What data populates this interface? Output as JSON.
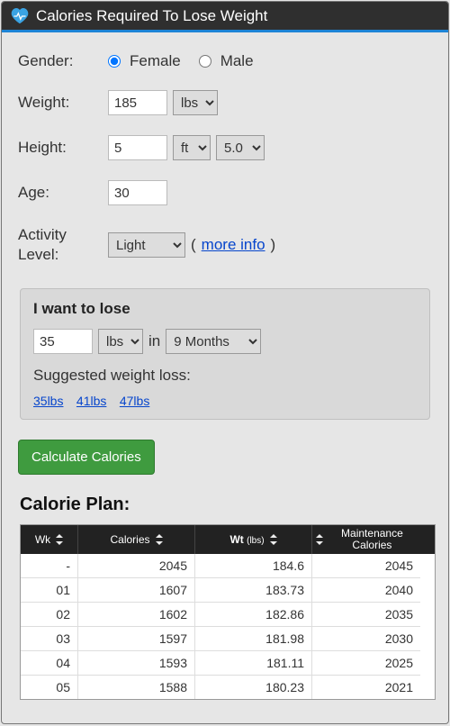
{
  "title": "Calories Required To Lose Weight",
  "form": {
    "gender": {
      "label": "Gender:",
      "female": "Female",
      "male": "Male",
      "selected": "female"
    },
    "weight": {
      "label": "Weight:",
      "value": "185",
      "unit": "lbs"
    },
    "height": {
      "label": "Height:",
      "value": "5",
      "unit": "ft",
      "inches": "5.0"
    },
    "age": {
      "label": "Age:",
      "value": "30"
    },
    "activity": {
      "label1": "Activity",
      "label2": "Level:",
      "value": "Light",
      "more_info": "more info"
    }
  },
  "lose": {
    "title": "I want to lose",
    "amount": "35",
    "unit": "lbs",
    "in_text": "in",
    "duration": "9 Months",
    "suggested_label": "Suggested weight loss:",
    "suggestions": [
      "35lbs",
      "41lbs",
      "47lbs"
    ]
  },
  "calc_label": "Calculate Calories",
  "plan_title": "Calorie Plan:",
  "columns": {
    "wk": "Wk",
    "calories": "Calories",
    "wt": "Wt",
    "wt_unit": "(lbs)",
    "maint": "Maintenance Calories"
  },
  "rows": [
    {
      "wk": "-",
      "cal": "2045",
      "wt": "184.6",
      "maint": "2045"
    },
    {
      "wk": "01",
      "cal": "1607",
      "wt": "183.73",
      "maint": "2040"
    },
    {
      "wk": "02",
      "cal": "1602",
      "wt": "182.86",
      "maint": "2035"
    },
    {
      "wk": "03",
      "cal": "1597",
      "wt": "181.98",
      "maint": "2030"
    },
    {
      "wk": "04",
      "cal": "1593",
      "wt": "181.11",
      "maint": "2025"
    },
    {
      "wk": "05",
      "cal": "1588",
      "wt": "180.23",
      "maint": "2021"
    }
  ]
}
